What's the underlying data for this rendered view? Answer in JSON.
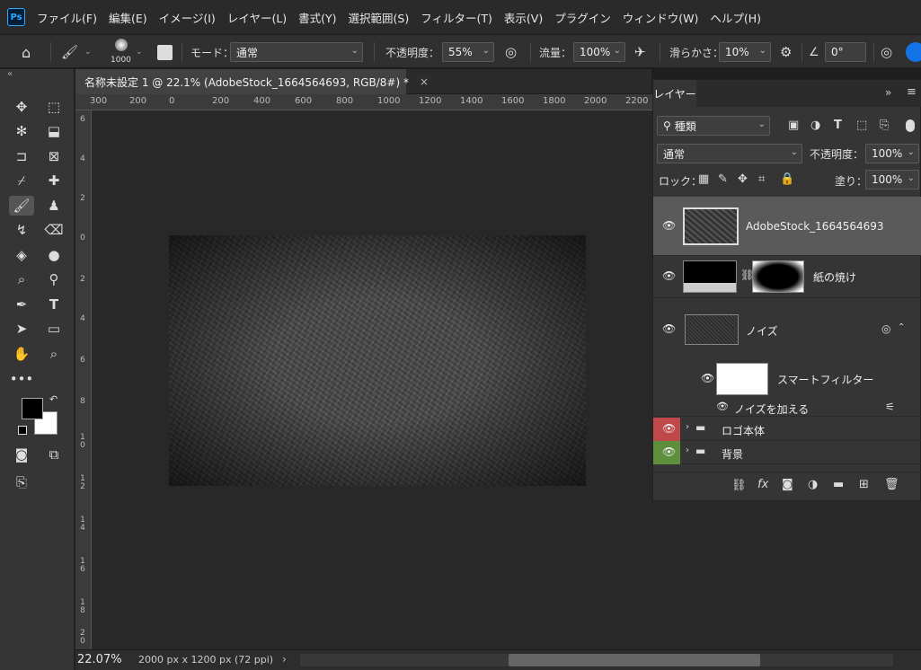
{
  "app": {
    "logo": "Ps"
  },
  "menu": [
    "ファイル(F)",
    "編集(E)",
    "イメージ(I)",
    "レイヤー(L)",
    "書式(Y)",
    "選択範囲(S)",
    "フィルター(T)",
    "表示(V)",
    "プラグイン",
    "ウィンドウ(W)",
    "ヘルプ(H)"
  ],
  "options": {
    "brush_size": "1000",
    "mode_label": "モード：",
    "mode_value": "通常",
    "opacity_label": "不透明度：",
    "opacity_value": "55%",
    "flow_label": "流量：",
    "flow_value": "100%",
    "smoothing_label": "滑らかさ：",
    "smoothing_value": "10%",
    "angle_value": "0°"
  },
  "document": {
    "tab_title": "名称未設定 1 @ 22.1% (AdobeStock_1664564693, RGB/8#) *",
    "zoom": "22.07%",
    "size": "2000 px x 1200 px (72 ppi)"
  },
  "ruler": {
    "h_labels": [
      "300",
      "200",
      "0",
      "200",
      "400",
      "600",
      "800",
      "1000",
      "1200",
      "1400",
      "1600",
      "1800",
      "2000",
      "2200"
    ],
    "v_labels": [
      "6",
      "4",
      "2",
      "0",
      "2",
      "4",
      "6",
      "8",
      "1 0",
      "1 2",
      "1 4",
      "1 6",
      "1 8",
      "2 0"
    ]
  },
  "layers_panel": {
    "tab": "レイヤー",
    "filter_kind": "種類",
    "blend_mode": "通常",
    "opacity_label": "不透明度：",
    "opacity_value": "100%",
    "lock_label": "ロック：",
    "fill_label": "塗り：",
    "fill_value": "100%",
    "layers": [
      {
        "name": "AdobeStock_1664564693"
      },
      {
        "name": "紙の焼け"
      },
      {
        "name": "ノイズ"
      },
      {
        "name": "スマートフィルター"
      },
      {
        "name": "ノイズを加える"
      },
      {
        "name": "ロゴ本体"
      },
      {
        "name": "背景"
      }
    ],
    "colors": {
      "logo_group": "#c0474a",
      "bg_group": "#5d8f3d",
      "selected": "#5a5a5a"
    }
  }
}
